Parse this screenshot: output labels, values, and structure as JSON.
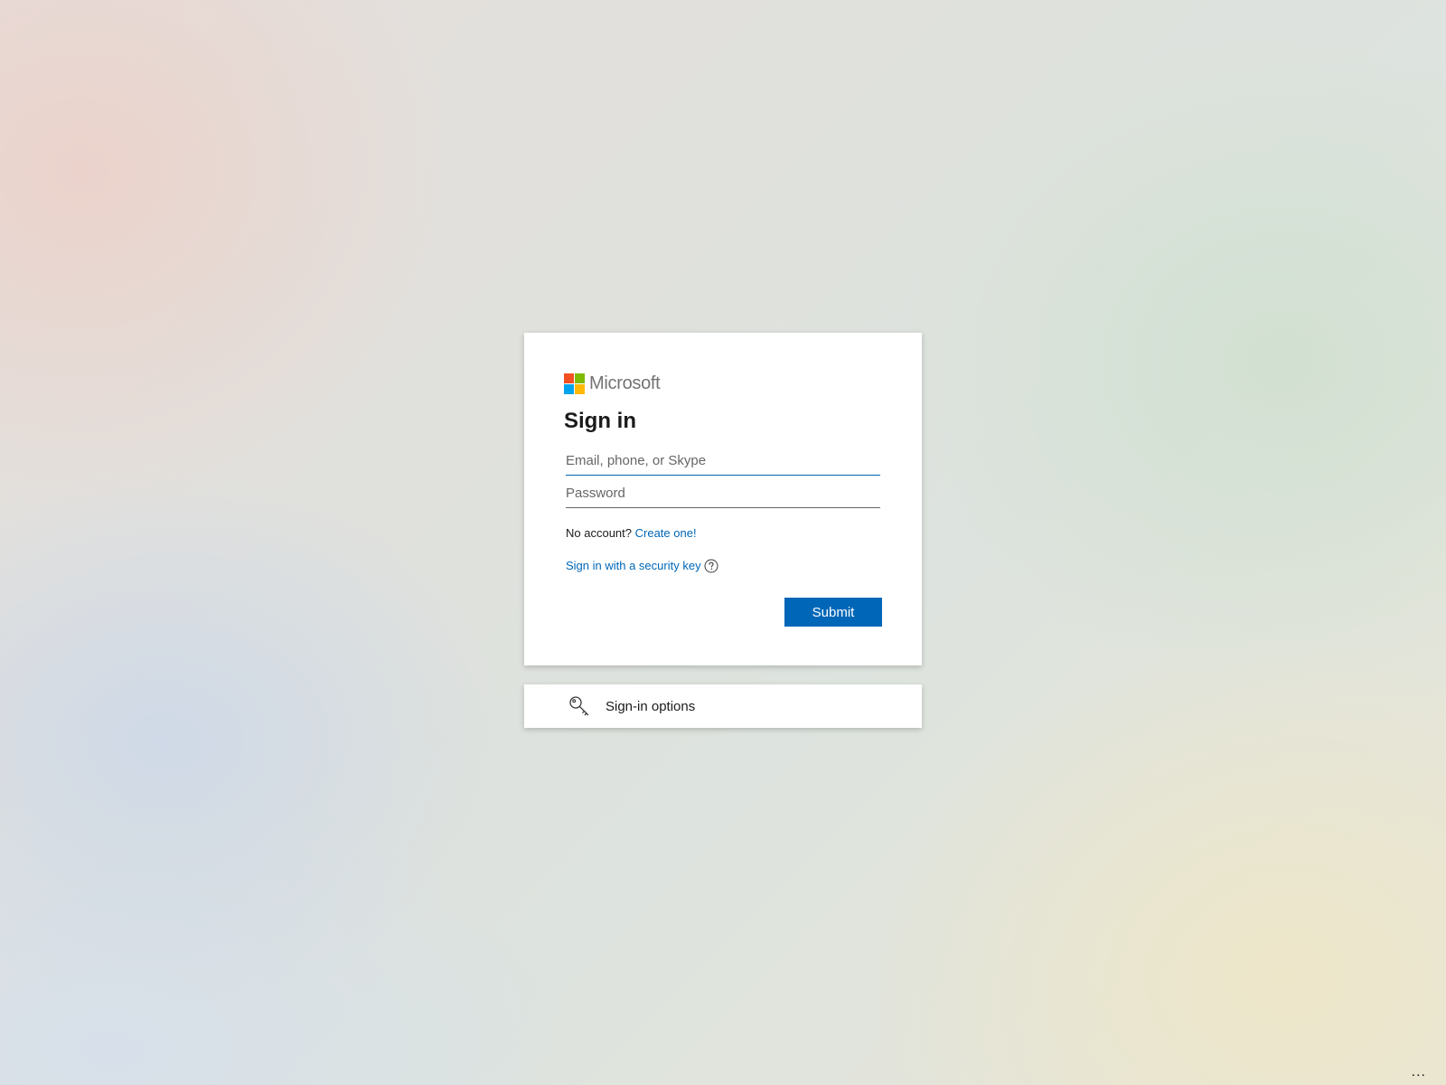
{
  "brand": {
    "name": "Microsoft",
    "logo_colors": [
      "#f25022",
      "#7fba00",
      "#00a4ef",
      "#ffb900"
    ]
  },
  "signin": {
    "title": "Sign in",
    "email_placeholder": "Email, phone, or Skype",
    "password_placeholder": "Password",
    "no_account_text": "No account?",
    "create_link": "Create one!",
    "security_key_link": "Sign in with a security key",
    "submit_label": "Submit"
  },
  "options": {
    "label": "Sign-in options",
    "icon": "key-icon"
  },
  "footer": {
    "more_label": "..."
  },
  "colors": {
    "accent": "#0067b8",
    "text": "#1b1b1b"
  }
}
